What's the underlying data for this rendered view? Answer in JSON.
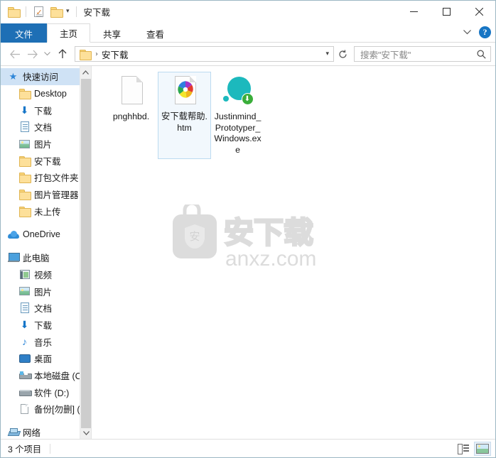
{
  "window": {
    "title": "安下载",
    "quick_access": [
      {
        "name": "properties-icon",
        "label": "属性"
      },
      {
        "name": "new-folder-icon",
        "label": "新建文件夹"
      }
    ],
    "customize_caret": "▾",
    "controls": {
      "minimize": "最小化",
      "maximize": "最大化",
      "close": "关闭"
    }
  },
  "ribbon": {
    "tabs": [
      {
        "label": "文件",
        "state": "file"
      },
      {
        "label": "主页",
        "state": "normal"
      },
      {
        "label": "共享",
        "state": "normal"
      },
      {
        "label": "查看",
        "state": "normal"
      }
    ],
    "expand_caret": "⌄",
    "help_label": "?"
  },
  "address": {
    "back_label": "后退",
    "forward_label": "前进",
    "recent_label": "最近浏览的位置",
    "up_label": "上移到",
    "breadcrumb": [
      {
        "label": "安下载"
      }
    ],
    "separator": "›",
    "dropdown_caret": "▾",
    "refresh_label": "刷新"
  },
  "search": {
    "placeholder": "搜索\"安下载\"",
    "icon": "search-icon"
  },
  "sidebar": {
    "items": [
      {
        "label": "快速访问",
        "icon": "star-icon",
        "level": 0,
        "selected": true,
        "pinned": false
      },
      {
        "label": "Desktop",
        "icon": "folder-icon",
        "level": 1,
        "selected": false,
        "pinned": true
      },
      {
        "label": "下载",
        "icon": "download-icon",
        "level": 1,
        "selected": false,
        "pinned": true
      },
      {
        "label": "文档",
        "icon": "document-icon",
        "level": 1,
        "selected": false,
        "pinned": true
      },
      {
        "label": "图片",
        "icon": "pictures-icon",
        "level": 1,
        "selected": false,
        "pinned": true
      },
      {
        "label": "安下载",
        "icon": "folder-icon",
        "level": 1,
        "selected": false,
        "pinned": false
      },
      {
        "label": "打包文件夹",
        "icon": "folder-icon",
        "level": 1,
        "selected": false,
        "pinned": false
      },
      {
        "label": "图片管理器",
        "icon": "folder-icon",
        "level": 1,
        "selected": false,
        "pinned": false
      },
      {
        "label": "未上传",
        "icon": "folder-icon",
        "level": 1,
        "selected": false,
        "pinned": false
      },
      {
        "label": "__GAP__",
        "icon": "",
        "level": 0,
        "selected": false,
        "pinned": false
      },
      {
        "label": "OneDrive",
        "icon": "cloud-icon",
        "level": 0,
        "selected": false,
        "pinned": false
      },
      {
        "label": "__GAP__",
        "icon": "",
        "level": 0,
        "selected": false,
        "pinned": false
      },
      {
        "label": "此电脑",
        "icon": "computer-icon",
        "level": 0,
        "selected": false,
        "pinned": false
      },
      {
        "label": "视频",
        "icon": "video-icon",
        "level": 1,
        "selected": false,
        "pinned": false
      },
      {
        "label": "图片",
        "icon": "pictures-icon",
        "level": 1,
        "selected": false,
        "pinned": false
      },
      {
        "label": "文档",
        "icon": "document-icon",
        "level": 1,
        "selected": false,
        "pinned": false
      },
      {
        "label": "下载",
        "icon": "download-icon",
        "level": 1,
        "selected": false,
        "pinned": false
      },
      {
        "label": "音乐",
        "icon": "music-icon",
        "level": 1,
        "selected": false,
        "pinned": false
      },
      {
        "label": "桌面",
        "icon": "desktop-icon",
        "level": 1,
        "selected": false,
        "pinned": false
      },
      {
        "label": "本地磁盘 (C:)",
        "icon": "system-drive-icon",
        "level": 1,
        "selected": false,
        "pinned": false
      },
      {
        "label": "软件 (D:)",
        "icon": "drive-icon",
        "level": 1,
        "selected": false,
        "pinned": false
      },
      {
        "label": "备份[勿删] (E:",
        "icon": "file-drive-icon",
        "level": 1,
        "selected": false,
        "pinned": false
      },
      {
        "label": "__GAP__",
        "icon": "",
        "level": 0,
        "selected": false,
        "pinned": false
      },
      {
        "label": "网络",
        "icon": "network-icon",
        "level": 0,
        "selected": false,
        "pinned": false
      }
    ],
    "scroll_up": "⌃",
    "scroll_down": "⌄"
  },
  "files": [
    {
      "name": "pnghhbd.",
      "icon": "blank-document-icon",
      "selected": false
    },
    {
      "name": "安下载帮助.htm",
      "icon": "html-document-icon",
      "selected": true
    },
    {
      "name": "Justinmind_Prototyper_Windows.exe",
      "icon": "justinmind-installer-icon",
      "selected": false
    }
  ],
  "watermark": {
    "logo_char": "安",
    "brand": "安下载",
    "site": "anxz.com",
    "color": "#dcdcdc"
  },
  "statusbar": {
    "item_count": "3 个项目",
    "views": [
      {
        "name": "details-view",
        "label": "详细信息",
        "active": false
      },
      {
        "name": "large-icons-view",
        "label": "大图标",
        "active": true
      }
    ]
  },
  "colors": {
    "accent": "#1e6fb5",
    "selection": "#cfe2f5",
    "file_selection": "#f2f8fd",
    "window_border": "#9bb7c4",
    "help_blue": "#1775c4",
    "teal": "#1cb9bd",
    "badge_green": "#3aae3a"
  }
}
